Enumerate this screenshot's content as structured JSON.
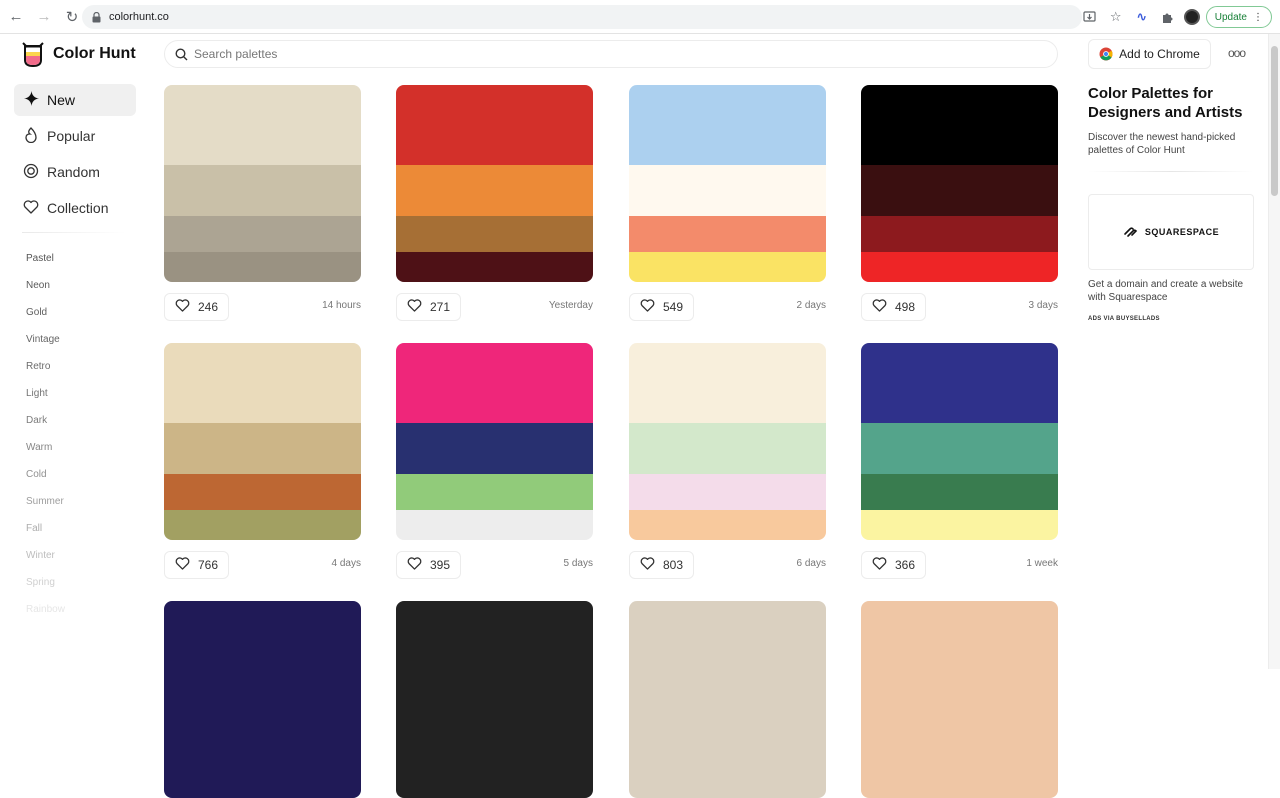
{
  "browser": {
    "url": "colorhunt.co",
    "update_label": "Update"
  },
  "header": {
    "logo_text": "Color Hunt",
    "search_placeholder": "Search palettes",
    "add_to_chrome_label": "Add to Chrome",
    "more_label": "ooo"
  },
  "sidebar": {
    "main": [
      {
        "label": "New",
        "icon": "sparkle-icon",
        "active": true
      },
      {
        "label": "Popular",
        "icon": "flame-icon",
        "active": false
      },
      {
        "label": "Random",
        "icon": "spiral-icon",
        "active": false
      },
      {
        "label": "Collection",
        "icon": "heart-icon",
        "active": false
      }
    ],
    "tags": [
      {
        "label": "Pastel",
        "color": "#555555"
      },
      {
        "label": "Neon",
        "color": "#5a5a5a"
      },
      {
        "label": "Gold",
        "color": "#5f5f5f"
      },
      {
        "label": "Vintage",
        "color": "#656565"
      },
      {
        "label": "Retro",
        "color": "#6c6c6c"
      },
      {
        "label": "Light",
        "color": "#747474"
      },
      {
        "label": "Dark",
        "color": "#7c7c7c"
      },
      {
        "label": "Warm",
        "color": "#868686"
      },
      {
        "label": "Cold",
        "color": "#919191"
      },
      {
        "label": "Summer",
        "color": "#9e9e9e"
      },
      {
        "label": "Fall",
        "color": "#adadad"
      },
      {
        "label": "Winter",
        "color": "#bdbdbd"
      },
      {
        "label": "Spring",
        "color": "#d0d0d0"
      },
      {
        "label": "Rainbow",
        "color": "#e6e6e6"
      }
    ]
  },
  "palettes": [
    {
      "colors": [
        "#e4dcc7",
        "#c9c0a8",
        "#aca493",
        "#9a9282"
      ],
      "likes": "246",
      "age": "14 hours"
    },
    {
      "colors": [
        "#d3302a",
        "#ec8a37",
        "#a66f35",
        "#4e1116"
      ],
      "likes": "271",
      "age": "Yesterday"
    },
    {
      "colors": [
        "#acd0ef",
        "#fff9ef",
        "#f38b6b",
        "#fae364"
      ],
      "likes": "549",
      "age": "2 days"
    },
    {
      "colors": [
        "#000000",
        "#3a0f10",
        "#8d1a1e",
        "#ee2526"
      ],
      "likes": "498",
      "age": "3 days"
    },
    {
      "colors": [
        "#eadbbb",
        "#ccb587",
        "#bd6733",
        "#a2a062"
      ],
      "likes": "766",
      "age": "4 days"
    },
    {
      "colors": [
        "#ef267a",
        "#283070",
        "#91cb7a",
        "#ededed"
      ],
      "likes": "395",
      "age": "5 days"
    },
    {
      "colors": [
        "#f8efdc",
        "#d3e8cb",
        "#f4dcea",
        "#f8c99d"
      ],
      "likes": "803",
      "age": "6 days"
    },
    {
      "colors": [
        "#2f318b",
        "#54a48b",
        "#397c4f",
        "#fbf4a1"
      ],
      "likes": "366",
      "age": "1 week"
    },
    {
      "colors": [
        "#201a57"
      ],
      "likes": "",
      "age": ""
    },
    {
      "colors": [
        "#222222"
      ],
      "likes": "",
      "age": ""
    },
    {
      "colors": [
        "#dad0c0"
      ],
      "likes": "",
      "age": ""
    },
    {
      "colors": [
        "#efc6a5"
      ],
      "likes": "",
      "age": ""
    }
  ],
  "right": {
    "title": "Color Palettes for Designers and Artists",
    "description": "Discover the newest hand-picked palettes of Color Hunt",
    "ad_brand": "SQUARESPACE",
    "ad_text": "Get a domain and create a website with Squarespace",
    "ad_via": "ADS VIA BUYSELLADS"
  }
}
